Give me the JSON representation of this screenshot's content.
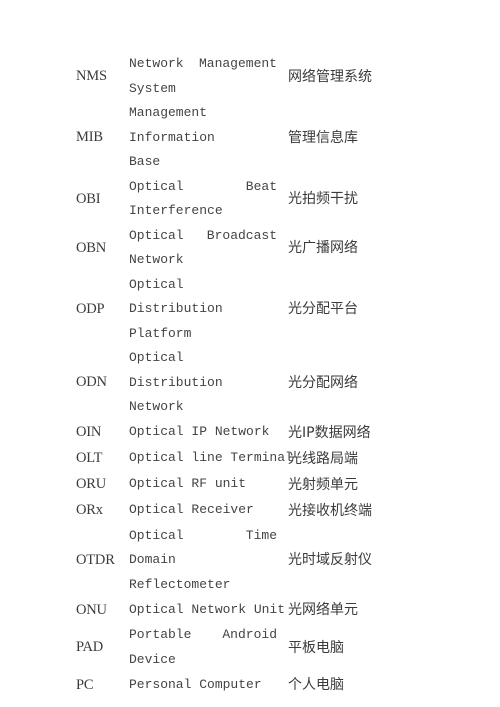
{
  "document": {
    "type": "glossary-table",
    "columns": [
      "abbreviation",
      "english_term",
      "chinese_term"
    ],
    "text_color": "#3b3b3b",
    "background_color": "#ffffff"
  },
  "rows": [
    {
      "abbr": "NMS",
      "en_line1": "Network Management",
      "en_line2": "System",
      "en_full": "Network Management System",
      "zh": "网络管理系统",
      "lines": 2
    },
    {
      "abbr": "MIB",
      "en_line1": "Management Information",
      "en_line2": "Base",
      "en_full": "Management Information Base",
      "zh": "管理信息库",
      "lines": 2
    },
    {
      "abbr": "OBI",
      "en_line1": "Optical Beat",
      "en_line2": "Interference",
      "en_full": "Optical Beat Interference",
      "zh": "光拍频干扰",
      "lines": 2
    },
    {
      "abbr": "OBN",
      "en_line1": "Optical Broadcast",
      "en_line2": "Network",
      "en_full": "Optical Broadcast Network",
      "zh": "光广播网络",
      "lines": 2
    },
    {
      "abbr": "ODP",
      "en_line1": "Optical Distribution",
      "en_line2": "Platform",
      "en_full": "Optical Distribution Platform",
      "zh": "光分配平台",
      "lines": 2
    },
    {
      "abbr": "ODN",
      "en_line1": "Optical Distribution",
      "en_line2": "Network",
      "en_full": "Optical Distribution Network",
      "zh": "光分配网络",
      "lines": 2
    },
    {
      "abbr": "OIN",
      "en_line1": "Optical IP Network",
      "en_line2": "",
      "en_full": "Optical IP Network",
      "zh": "光IP数据网络",
      "lines": 1
    },
    {
      "abbr": "OLT",
      "en_line1": "Optical line Terminal",
      "en_line2": "",
      "en_full": "Optical line Terminal",
      "zh": "光线路局端",
      "lines": 1
    },
    {
      "abbr": "ORU",
      "en_line1": "Optical RF unit",
      "en_line2": "",
      "en_full": "Optical RF unit",
      "zh": "光射频单元",
      "lines": 1
    },
    {
      "abbr": "ORx",
      "en_line1": "Optical Receiver",
      "en_line2": "",
      "en_full": "Optical Receiver",
      "zh": "光接收机终端",
      "lines": 1
    },
    {
      "abbr": "OTDR",
      "en_line1": "Optical Time Domain",
      "en_line2": "Reflectometer",
      "en_full": "Optical Time Domain Reflectometer",
      "zh": "光时域反射仪",
      "lines": 2
    },
    {
      "abbr": "ONU",
      "en_line1": "Optical Network Unit",
      "en_line2": "",
      "en_full": "Optical Network Unit",
      "zh": "光网络单元",
      "lines": 1
    },
    {
      "abbr": "PAD",
      "en_line1": "Portable Android",
      "en_line2": "Device",
      "en_full": "Portable Android Device",
      "zh": "平板电脑",
      "lines": 2
    },
    {
      "abbr": "PC",
      "en_line1": "Personal Computer",
      "en_line2": "",
      "en_full": "Personal Computer",
      "zh": "个人电脑",
      "lines": 1
    }
  ]
}
